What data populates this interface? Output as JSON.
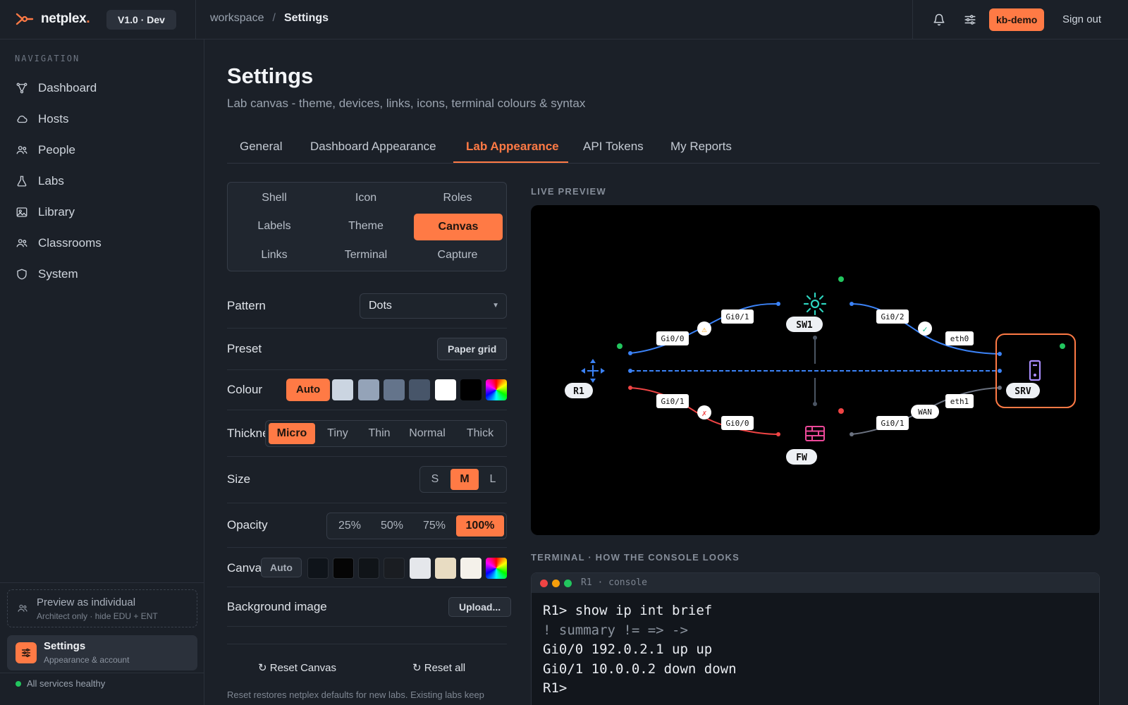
{
  "app": {
    "name": "netplex",
    "version": "V1.0 · Dev"
  },
  "breadcrumb": {
    "root": "workspace",
    "separator": "/",
    "current": "Settings"
  },
  "header": {
    "user": "kb-demo",
    "signout": "Sign out",
    "accent": "#ff7a45"
  },
  "sidebar": {
    "title": "NAVIGATION",
    "items": [
      {
        "label": "Dashboard",
        "icon": "graph-icon"
      },
      {
        "label": "Hosts",
        "icon": "cloud-icon"
      },
      {
        "label": "People",
        "icon": "people-icon"
      },
      {
        "label": "Labs",
        "icon": "flask-icon"
      },
      {
        "label": "Library",
        "icon": "image-icon"
      },
      {
        "label": "Classrooms",
        "icon": "people-icon"
      },
      {
        "label": "System",
        "icon": "shield-icon"
      }
    ],
    "preview": {
      "title": "Preview as individual",
      "subtitle": "Architect only · hide EDU + ENT"
    },
    "settings": {
      "title": "Settings",
      "subtitle": "Appearance & account"
    },
    "status": "All services healthy"
  },
  "page": {
    "title": "Settings",
    "subtitle": "Lab canvas - theme, devices, links, icons, terminal colours & syntax",
    "tabs": [
      "General",
      "Dashboard Appearance",
      "Lab Appearance",
      "API Tokens",
      "My Reports"
    ],
    "active_tab": "Lab Appearance"
  },
  "subtabs": {
    "items": [
      "Shell",
      "Icon",
      "Roles",
      "Labels",
      "Theme",
      "Canvas",
      "Links",
      "Terminal",
      "Capture"
    ],
    "active": "Canvas"
  },
  "settings": {
    "pattern": {
      "label": "Pattern",
      "value": "Dots"
    },
    "preset": {
      "label": "Preset",
      "button": "Paper grid"
    },
    "colour": {
      "label": "Colour",
      "auto": "Auto",
      "swatches": [
        "#cbd5e1",
        "#94a3b8",
        "#64748b",
        "#475569",
        "#ffffff",
        "#000000"
      ]
    },
    "thickness": {
      "label": "Thickness",
      "options": [
        "Micro",
        "Tiny",
        "Thin",
        "Normal",
        "Thick"
      ],
      "selected": "Micro"
    },
    "size": {
      "label": "Size",
      "options": [
        "S",
        "M",
        "L"
      ],
      "selected": "M"
    },
    "opacity": {
      "label": "Opacity",
      "options": [
        "25%",
        "50%",
        "75%",
        "100%"
      ],
      "selected": "100%"
    },
    "canvas": {
      "label": "Canvas",
      "auto": "Auto",
      "swatches": [
        "#0f141a",
        "#050505",
        "#101418",
        "#1a1d22",
        "#e5e7eb",
        "#e8dcc2",
        "#f4f1ea"
      ]
    },
    "background_image": {
      "label": "Background image",
      "button": "Upload..."
    },
    "reset_canvas": "Reset Canvas",
    "reset_all": "Reset all",
    "note": "Reset restores netplex defaults for new labs. Existing labs keep"
  },
  "preview": {
    "title": "LIVE PREVIEW",
    "nodes": {
      "r1": "R1",
      "sw1": "SW1",
      "fw": "FW",
      "srv": "SRV"
    },
    "links": {
      "r1_sw1_a": "Gi0/0",
      "r1_sw1_b": "Gi0/1",
      "sw1_srv_a": "Gi0/2",
      "sw1_srv_b": "eth0",
      "r1_fw_a": "Gi0/1",
      "r1_fw_b": "Gi0/0",
      "fw_srv_a": "Gi0/1",
      "fw_srv_wan": "WAN",
      "fw_srv_b": "eth1"
    },
    "colors": {
      "link_up": "#3b82f6",
      "link_down": "#ef4444",
      "switch": "#2dd4bf",
      "firewall": "#ec4899",
      "server": "#a78bfa",
      "router": "#3b82f6"
    }
  },
  "terminal": {
    "title": "TERMINAL · HOW THE CONSOLE LOOKS",
    "window_title": "R1 · console",
    "lines": [
      "R1> show ip int brief",
      "! summary != => ->",
      "Gi0/0 192.0.2.1 up up",
      "Gi0/1 10.0.0.2 down down",
      "R1>"
    ]
  }
}
